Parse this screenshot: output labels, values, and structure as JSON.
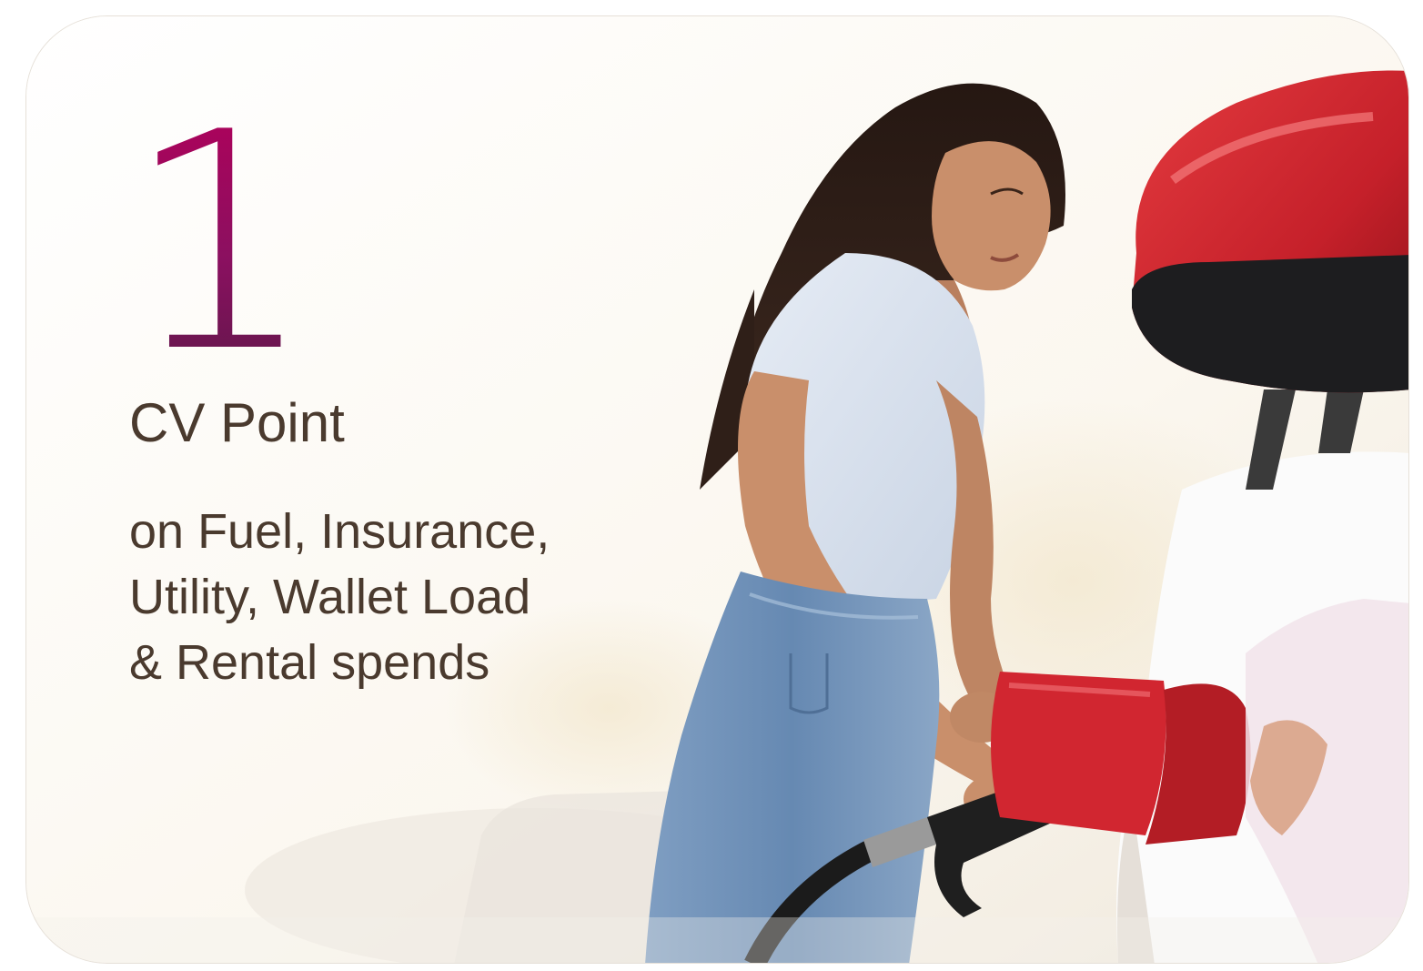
{
  "card": {
    "number": "1",
    "headline": "CV Point",
    "details_lines": [
      "on Fuel, Insurance,",
      "Utility, Wallet Load",
      "& Rental spends"
    ]
  },
  "photo": {
    "subject": "woman-refueling-car-icon"
  },
  "colors": {
    "number_gradient_top": "#b1005a",
    "number_gradient_bottom": "#5d1849",
    "text": "#4a3a2e",
    "car_red": "#c8202c",
    "jeans_blue": "#6f8fb3",
    "shirt_light_blue": "#d8e1ee",
    "hair_dark": "#2b1c17"
  }
}
